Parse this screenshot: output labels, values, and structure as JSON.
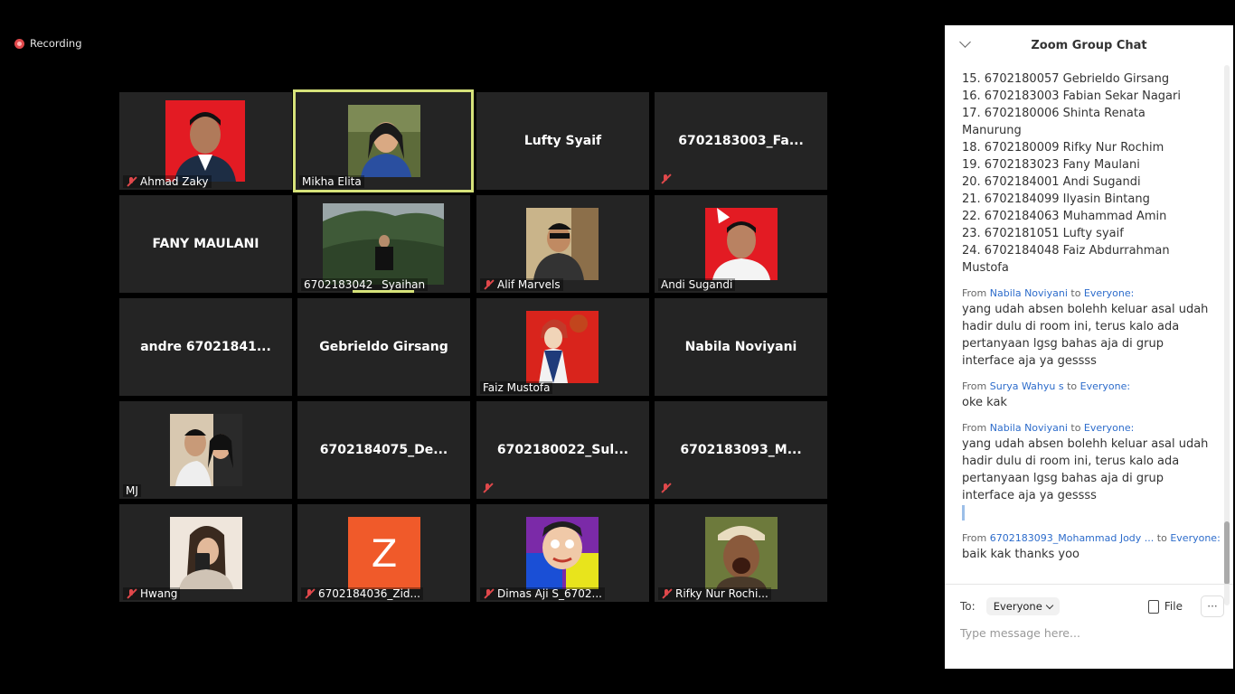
{
  "recording": {
    "label": "Recording"
  },
  "participants": [
    {
      "name": "Ahmad Zaky"
    },
    {
      "name": "Mikha Elita"
    },
    {
      "name": "Lufty Syaif"
    },
    {
      "name": "6702183003_Fa..."
    },
    {
      "name": "FANY MAULANI"
    },
    {
      "name": "6702183042 _Syaihan"
    },
    {
      "name": "Alif Marvels"
    },
    {
      "name": "Andi Sugandi"
    },
    {
      "name": "andre 67021841..."
    },
    {
      "name": "Gebrieldo Girsang"
    },
    {
      "name": "Faiz Mustofa"
    },
    {
      "name": "Nabila Noviyani"
    },
    {
      "name": "MJ"
    },
    {
      "name": "6702184075_De..."
    },
    {
      "name": "6702180022_Sul..."
    },
    {
      "name": "6702183093_M..."
    },
    {
      "name": "Hwang"
    },
    {
      "name": "6702184036_Zid..."
    },
    {
      "name": "Dimas Aji S_6702..."
    },
    {
      "name": "Rifky Nur Rochi..."
    }
  ],
  "avatar_letter": "Z",
  "chat": {
    "title": "Zoom Group Chat",
    "list_lines": [
      "15. 6702180057 Gebrieldo Girsang",
      "16. 6702183003 Fabian Sekar Nagari",
      "17. 6702180006 Shinta Renata",
      "Manurung",
      "18. 6702180009 Rifky Nur Rochim",
      "19. 6702183023 Fany Maulani",
      "20. 6702184001 Andi Sugandi",
      "21. 6702184099 Ilyasin Bintang",
      "22. 6702184063 Muhammad Amin",
      "23. 6702181051 Lufty syaif",
      "24.  6702184048 Faiz Abdurrahman",
      "Mustofa"
    ],
    "messages": [
      {
        "from_prefix": "From",
        "sender": "Nabila Noviyani",
        "to_word": "to",
        "recipient": "Everyone:",
        "text": "yang udah absen bolehh keluar asal udah hadir dulu di room ini, terus kalo ada pertanyaan lgsg bahas aja di grup interface aja ya gessss"
      },
      {
        "from_prefix": "From",
        "sender": "Surya Wahyu s",
        "to_word": "to",
        "recipient": "Everyone:",
        "text": "oke kak"
      },
      {
        "from_prefix": "From",
        "sender": "Nabila Noviyani",
        "to_word": "to",
        "recipient": "Everyone:",
        "text": "yang udah absen bolehh keluar asal udah hadir dulu di room ini, terus kalo ada pertanyaan lgsg bahas aja di grup interface aja ya gessss"
      },
      {
        "from_prefix": "From",
        "sender": "6702183093_Mohammad Jody ...",
        "to_word": "to",
        "recipient": "Everyone:",
        "text": "baik kak thanks yoo"
      }
    ],
    "to_label": "To:",
    "to_value": "Everyone",
    "file_label": "File",
    "more_label": "···",
    "input_placeholder": "Type message here..."
  }
}
